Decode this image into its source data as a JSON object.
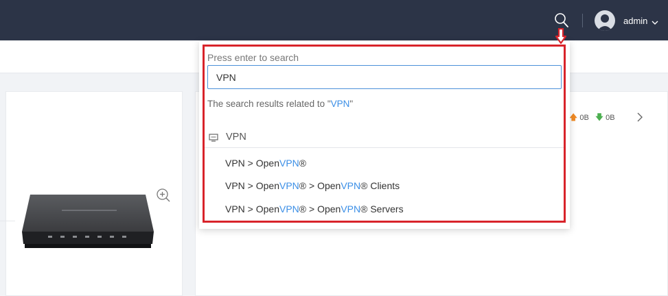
{
  "header": {
    "username": "admin"
  },
  "search": {
    "label": "Press enter to search",
    "value": "VPN",
    "results_prefix": "The search results related to ",
    "results_open_quote": "\"",
    "results_term": "VPN",
    "results_close_quote": "\"",
    "group_label": "VPN",
    "results": [
      {
        "a": "VPN > Open",
        "b": "VPN",
        "c": "®"
      },
      {
        "a": "VPN > Open",
        "b": "VPN",
        "c": "® > Open",
        "d": "VPN",
        "e": "® Clients"
      },
      {
        "a": "VPN > Open",
        "b": "VPN",
        "c": "® > Open",
        "d": "VPN",
        "e": "® Servers"
      }
    ]
  },
  "traffic": {
    "upload": "0B",
    "download": "0B"
  },
  "colors": {
    "topbar": "#2c3447",
    "accent": "#3a8ee6",
    "highlight": "#d8232a",
    "upload_arrow": "#f08a24",
    "download_arrow": "#4caf50"
  }
}
